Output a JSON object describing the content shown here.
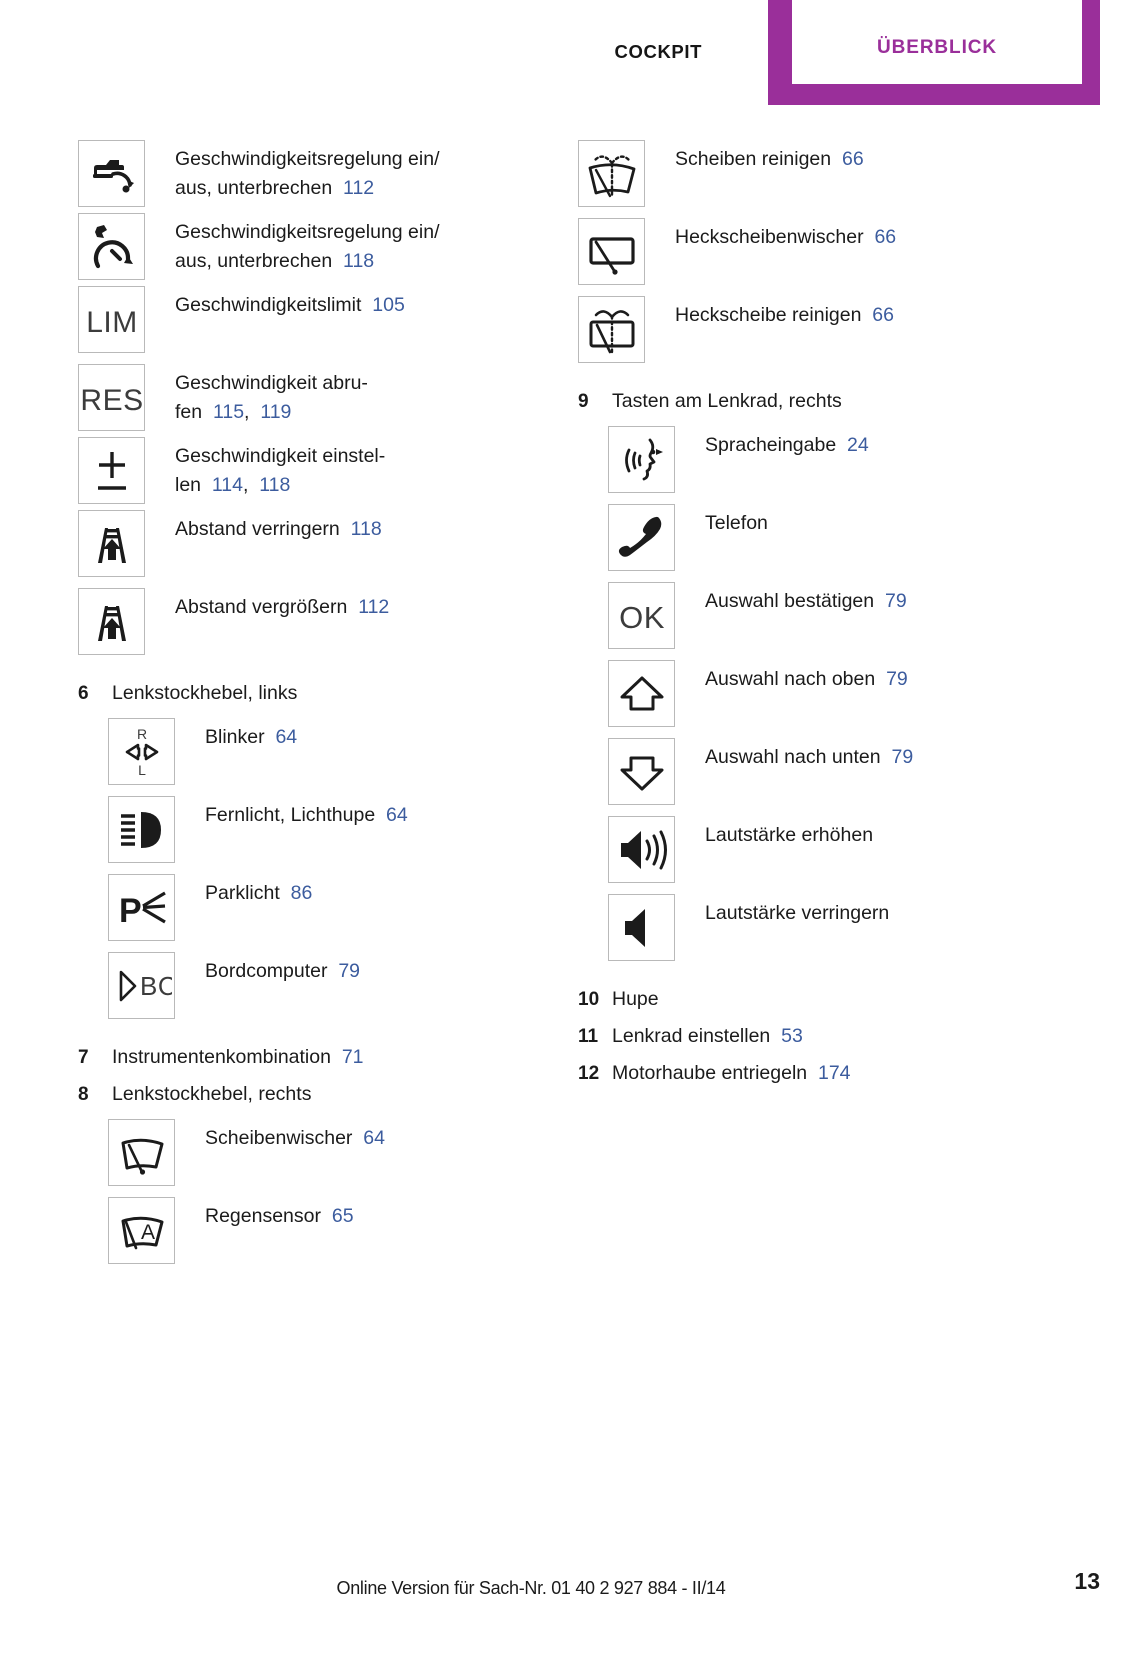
{
  "header": {
    "inactive_tab": "COCKPIT",
    "active_tab": "ÜBERBLICK",
    "accent_color": "#9a2f9a"
  },
  "link_color": "#3c5c9e",
  "left_column": [
    {
      "kind": "icon",
      "icon": "cruise-control-car-icon",
      "lines": [
        {
          "text": "Geschwindigkeitsregelung ein/",
          "page": ""
        },
        {
          "text": "aus, unterbrechen",
          "page": "112"
        }
      ]
    },
    {
      "kind": "icon",
      "icon": "cruise-control-gauge-icon",
      "lines": [
        {
          "text": "Geschwindigkeitsregelung ein/",
          "page": ""
        },
        {
          "text": "aus, unterbrechen",
          "page": "118"
        }
      ]
    },
    {
      "kind": "icon",
      "icon": "lim-icon",
      "icon_text": "LIM",
      "lines": [
        {
          "text": "Geschwindigkeitslimit",
          "page": "105"
        }
      ]
    },
    {
      "kind": "icon",
      "icon": "res-icon",
      "icon_text": "RES",
      "lines": [
        {
          "text": "Geschwindigkeit abru-",
          "page": ""
        },
        {
          "text": "fen",
          "page": "115",
          "page2": "119",
          "sep": ","
        }
      ]
    },
    {
      "kind": "icon",
      "icon": "plus-minus-icon",
      "lines": [
        {
          "text": "Geschwindigkeit einstel-",
          "page": ""
        },
        {
          "text": "len",
          "page": "114",
          "page2": "118",
          "sep": ","
        }
      ]
    },
    {
      "kind": "icon",
      "icon": "distance-decrease-icon",
      "lines": [
        {
          "text": "Abstand verringern",
          "page": "118"
        }
      ]
    },
    {
      "kind": "icon",
      "icon": "distance-increase-icon",
      "lines": [
        {
          "text": "Abstand vergrößern",
          "page": "112"
        }
      ]
    },
    {
      "kind": "numbered",
      "number": "6",
      "text": "Lenkstockhebel, links",
      "page": ""
    },
    {
      "kind": "icon",
      "indent": true,
      "icon": "turn-signal-icon",
      "lines": [
        {
          "text": "Blinker",
          "page": "64"
        }
      ]
    },
    {
      "kind": "icon",
      "indent": true,
      "icon": "high-beam-icon",
      "lines": [
        {
          "text": "Fernlicht, Lichthupe",
          "page": "64"
        }
      ]
    },
    {
      "kind": "icon",
      "indent": true,
      "icon": "parking-light-icon",
      "lines": [
        {
          "text": "Parklicht",
          "page": "86"
        }
      ]
    },
    {
      "kind": "icon",
      "indent": true,
      "icon": "onboard-computer-icon",
      "icon_text": "BC",
      "lines": [
        {
          "text": "Bordcomputer",
          "page": "79"
        }
      ]
    },
    {
      "kind": "numbered",
      "number": "7",
      "text": "Instrumentenkombination",
      "page": "71"
    },
    {
      "kind": "numbered",
      "number": "8",
      "text": "Lenkstockhebel, rechts",
      "page": ""
    },
    {
      "kind": "icon",
      "indent": true,
      "icon": "windshield-wiper-icon",
      "lines": [
        {
          "text": "Scheibenwischer",
          "page": "64"
        }
      ]
    },
    {
      "kind": "icon",
      "indent": true,
      "icon": "rain-sensor-icon",
      "lines": [
        {
          "text": "Regensensor",
          "page": "65"
        }
      ]
    }
  ],
  "right_column": [
    {
      "kind": "icon",
      "icon": "windshield-washer-icon",
      "lines": [
        {
          "text": "Scheiben reinigen",
          "page": "66"
        }
      ]
    },
    {
      "kind": "icon",
      "icon": "rear-wiper-icon",
      "lines": [
        {
          "text": "Heckscheibenwischer",
          "page": "66"
        }
      ]
    },
    {
      "kind": "icon",
      "icon": "rear-washer-icon",
      "lines": [
        {
          "text": "Heckscheibe reinigen",
          "page": "66"
        }
      ]
    },
    {
      "kind": "numbered",
      "number": "9",
      "text": "Tasten am Lenkrad, rechts",
      "page": ""
    },
    {
      "kind": "icon",
      "indent": true,
      "icon": "voice-input-icon",
      "lines": [
        {
          "text": "Spracheingabe",
          "page": "24"
        }
      ]
    },
    {
      "kind": "icon",
      "indent": true,
      "icon": "telephone-icon",
      "lines": [
        {
          "text": "Telefon",
          "page": ""
        }
      ]
    },
    {
      "kind": "icon",
      "indent": true,
      "icon": "ok-icon",
      "icon_text": "OK",
      "lines": [
        {
          "text": "Auswahl bestätigen",
          "page": "79"
        }
      ]
    },
    {
      "kind": "icon",
      "indent": true,
      "icon": "arrow-up-icon",
      "lines": [
        {
          "text": "Auswahl nach oben",
          "page": "79"
        }
      ]
    },
    {
      "kind": "icon",
      "indent": true,
      "icon": "arrow-down-icon",
      "lines": [
        {
          "text": "Auswahl nach unten",
          "page": "79"
        }
      ]
    },
    {
      "kind": "icon",
      "indent": true,
      "icon": "volume-up-icon",
      "lines": [
        {
          "text": "Lautstärke erhöhen",
          "page": ""
        }
      ]
    },
    {
      "kind": "icon",
      "indent": true,
      "icon": "volume-down-icon",
      "lines": [
        {
          "text": "Lautstärke verringern",
          "page": ""
        }
      ]
    },
    {
      "kind": "numbered",
      "number": "10",
      "text": "Hupe",
      "page": ""
    },
    {
      "kind": "numbered",
      "number": "11",
      "text": "Lenkrad einstellen",
      "page": "53"
    },
    {
      "kind": "numbered",
      "number": "12",
      "text": "Motorhaube entriegeln",
      "page": "174"
    }
  ],
  "footer": {
    "note": "Online Version für Sach-Nr. 01 40 2 927 884 - II/14",
    "page_number": "13"
  }
}
